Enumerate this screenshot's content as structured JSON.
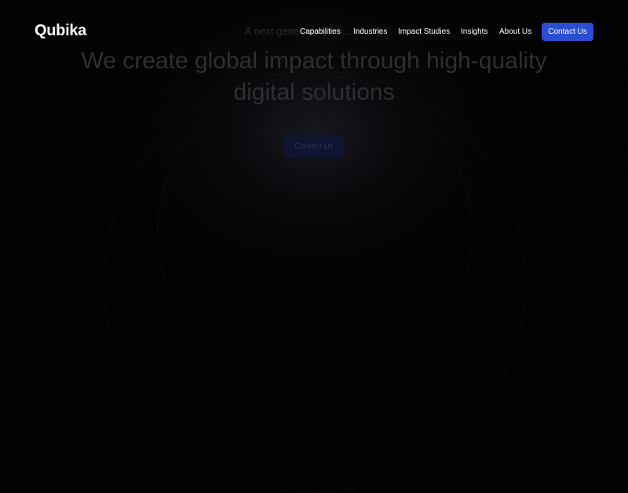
{
  "brand": {
    "logo_text": "Qubika"
  },
  "nav": {
    "items": [
      {
        "label": "Capabilities"
      },
      {
        "label": "Industries"
      },
      {
        "label": "Impact Studies"
      },
      {
        "label": "Insights"
      },
      {
        "label": "About Us"
      }
    ],
    "contact_label": "Contact Us"
  },
  "hero": {
    "eyebrow": "A next generation mo... al ...ro",
    "title": "We create global impact through high-quality digital solutions",
    "cta_label": "Contact Us"
  },
  "colors": {
    "accent": "#2a4fd6",
    "background": "#020203"
  }
}
